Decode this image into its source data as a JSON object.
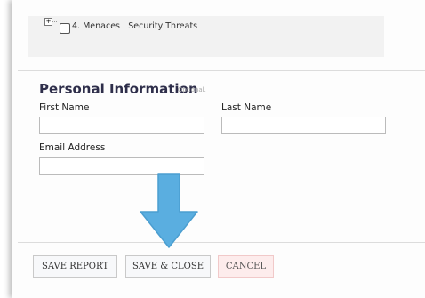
{
  "tree": {
    "expander_symbol": "+",
    "item_label": "4. Menaces | Security Threats"
  },
  "personal": {
    "title": "Personal Information",
    "optional_hint": "Optional."
  },
  "fields": {
    "first_name_label": "First Name",
    "first_name_value": "",
    "last_name_label": "Last Name",
    "last_name_value": "",
    "email_label": "Email Address",
    "email_value": ""
  },
  "buttons": {
    "save_report": "SAVE REPORT",
    "save_close": "SAVE & CLOSE",
    "cancel": "CANCEL"
  },
  "colors": {
    "arrow_fill": "#5aaee0",
    "cancel_bg": "#fdecec",
    "title_color": "#2e2e4a"
  },
  "annotation": {
    "arrow_icon": "down-arrow-icon"
  }
}
